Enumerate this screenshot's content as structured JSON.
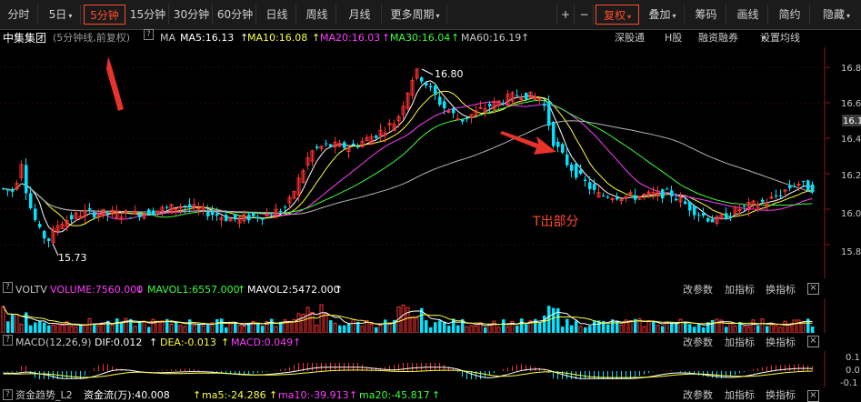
{
  "toolbar": {
    "periods": [
      "分时",
      "5日",
      "5分钟",
      "15分钟",
      "30分钟",
      "60分钟",
      "日线",
      "周线",
      "月线",
      "更多周期"
    ],
    "active_period": "5分钟",
    "plus": "+",
    "minus": "−",
    "fuquan": "复权",
    "diejia": "叠加",
    "chouma": "筹码",
    "huaxian": "画线",
    "jianyue": "简约",
    "yincang": "隐藏"
  },
  "info": {
    "stock_name": "中集集团",
    "desc": "(5分钟线,前复权)",
    "ma_label": "MA",
    "ma5": "MA5:16.13",
    "ma10": "MA10:16.08",
    "ma20": "MA20:16.03",
    "ma30": "MA30:16.04",
    "ma60": "MA60:16.19",
    "links": [
      "深股通",
      "H股",
      "融资融券",
      "设置均线"
    ]
  },
  "colors": {
    "up": "#ff3232",
    "down": "#00e5ff",
    "ma5": "#ffffff",
    "ma10": "#ffff3c",
    "ma20": "#ff3cff",
    "ma30": "#3cff3c",
    "ma60": "#b4b4b4",
    "annotation": "#ff4b2b"
  },
  "main_chart": {
    "high_label": "16.80",
    "low_label": "15.73",
    "annotation": "T出部分",
    "yaxis": [
      "16.8",
      "16.6",
      "16.4",
      "16.2",
      "16.0",
      "15.8"
    ],
    "current_price": "16.1"
  },
  "volume_panel": {
    "name": "VOLTV",
    "volume": "VOLUME:7560.000",
    "mavol1": "MAVOL1:6557.000",
    "mavol2": "MAVOL2:5472.000",
    "buttons": [
      "改参数",
      "加指标",
      "换指标"
    ]
  },
  "macd_panel": {
    "name": "MACD(12,26,9)",
    "dif": "DIF:0.012",
    "dea": "DEA:-0.013",
    "macd": "MACD:0.049",
    "buttons": [
      "改参数",
      "加指标",
      "换指标"
    ],
    "yaxis": [
      "0.1",
      "0.0",
      "-0.1"
    ]
  },
  "fund_panel": {
    "name": "资金趋势_L2",
    "flow": "资金流(万):40.008",
    "ma5": "ma5:-24.286",
    "ma10": "ma10:-39.913",
    "ma20": "ma20:-45.817",
    "buttons": [
      "改参数",
      "加指标",
      "换指标"
    ]
  }
}
